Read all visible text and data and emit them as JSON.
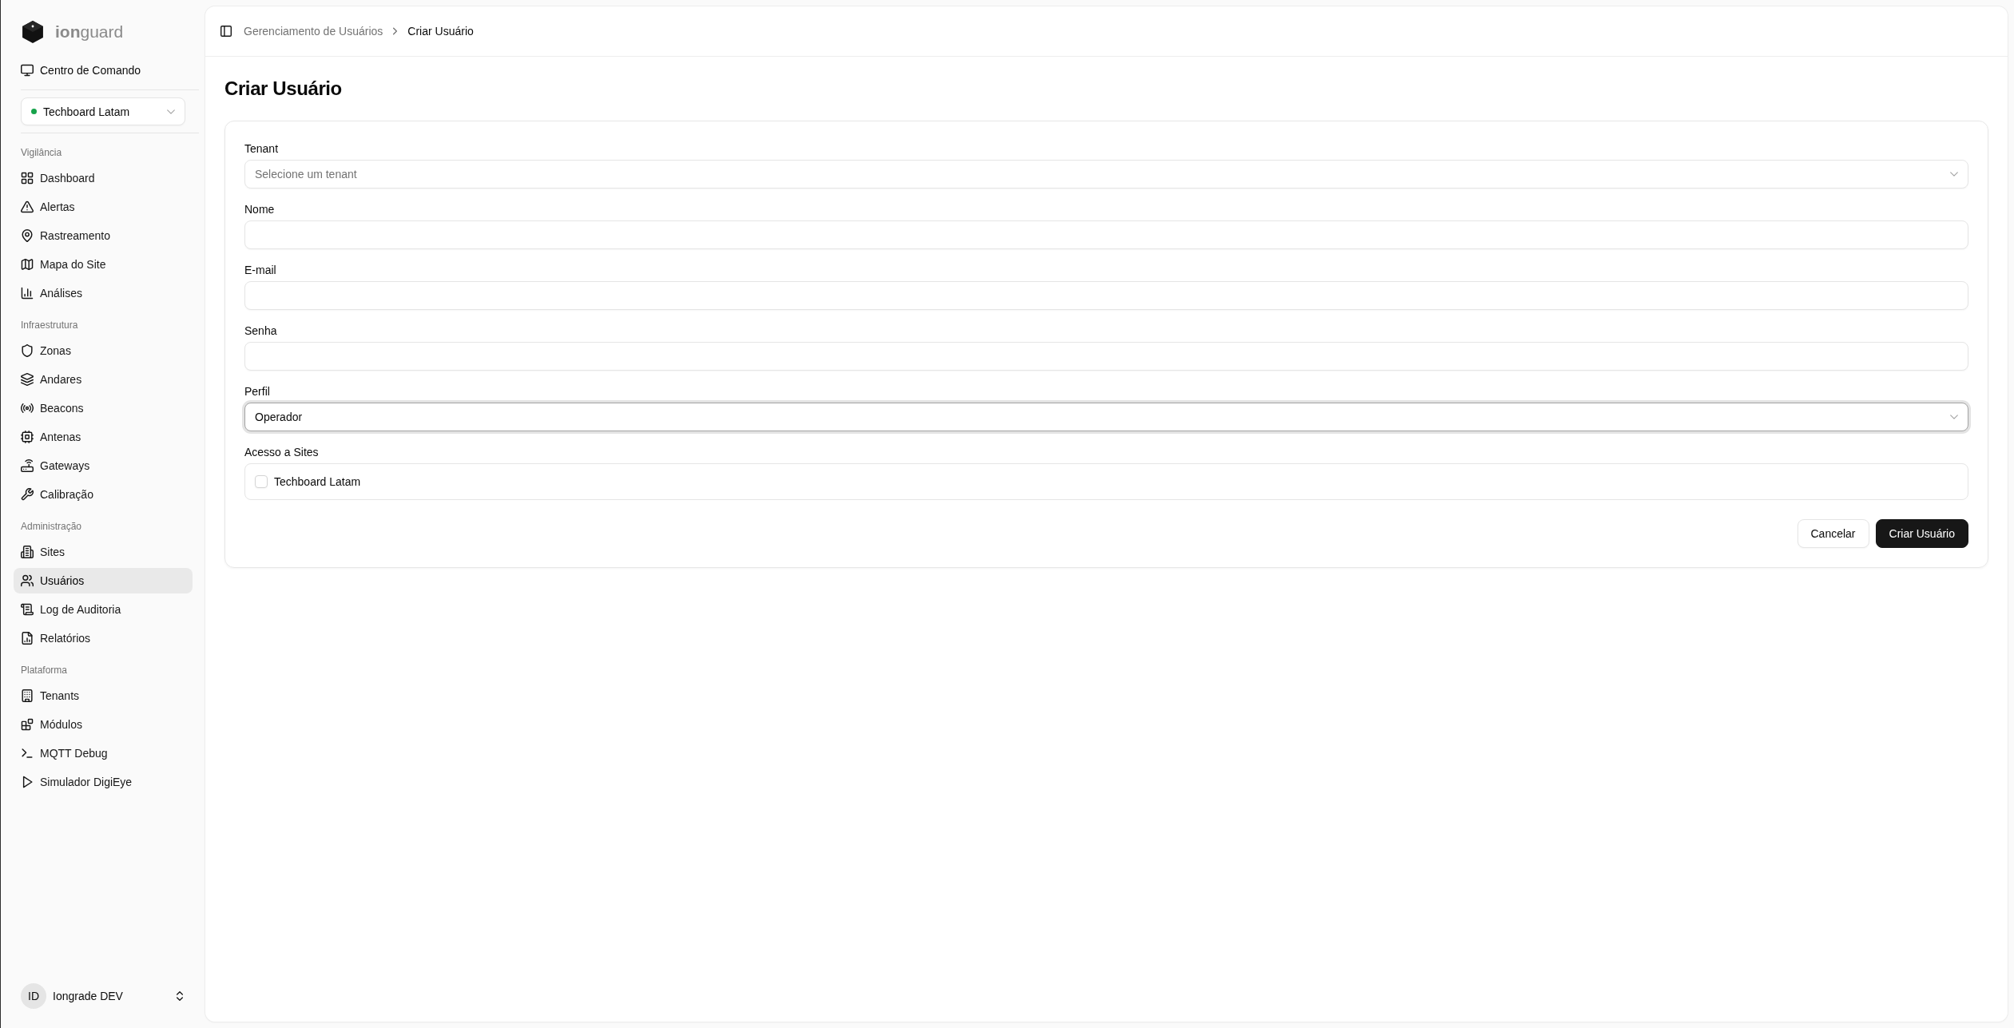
{
  "sidebar": {
    "brand": "**ion**guard",
    "command_center": {
      "label": "Centro de Comando"
    },
    "site_switcher": {
      "label": "Techboard Latam",
      "online": true
    },
    "groups": [
      {
        "label": "Vigilância",
        "items": [
          {
            "label": "Dashboard",
            "selected": false
          },
          {
            "label": "Alertas",
            "selected": false
          },
          {
            "label": "Rastreamento",
            "selected": false
          },
          {
            "label": "Mapa do Site",
            "selected": false
          },
          {
            "label": "Análises",
            "selected": false
          }
        ]
      },
      {
        "label": "Infraestrutura",
        "items": [
          {
            "label": "Zonas",
            "selected": false
          },
          {
            "label": "Andares",
            "selected": false
          },
          {
            "label": "Beacons",
            "selected": false
          },
          {
            "label": "Antenas",
            "selected": false
          },
          {
            "label": "Gateways",
            "selected": false
          },
          {
            "label": "Calibração",
            "selected": false
          }
        ]
      },
      {
        "label": "Administração",
        "items": [
          {
            "label": "Sites",
            "selected": false
          },
          {
            "label": "Usuários",
            "selected": true
          },
          {
            "label": "Log de Auditoria",
            "selected": false
          },
          {
            "label": "Relatórios",
            "selected": false
          }
        ]
      },
      {
        "label": "Plataforma",
        "items": [
          {
            "label": "Tenants",
            "selected": false
          },
          {
            "label": "Módulos",
            "selected": false
          },
          {
            "label": "MQTT Debug",
            "selected": false
          },
          {
            "label": "Simulador DigiEye",
            "selected": false
          }
        ]
      }
    ],
    "user": {
      "initials": "ID",
      "name": "Iongrade DEV"
    }
  },
  "header": {
    "breadcrumb": [
      {
        "label": "Gerenciamento de Usuários",
        "current": false
      },
      {
        "label": "Criar Usuário",
        "current": true
      }
    ]
  },
  "page": {
    "title": "Criar Usuário"
  },
  "form": {
    "fields": [
      {
        "label": "Tenant",
        "kind": "select",
        "placeholder": "Selecione um tenant",
        "focused": false
      },
      {
        "label": "Nome",
        "kind": "input",
        "focused": false
      },
      {
        "label": "E-mail",
        "kind": "input",
        "focused": false
      },
      {
        "label": "Senha",
        "kind": "input",
        "focused": false
      },
      {
        "label": "Perfil",
        "kind": "select",
        "value": "Operador",
        "focused": true
      },
      {
        "label": "Acesso a Sites",
        "kind": "checklist",
        "focused": false,
        "options": [
          {
            "label": "Techboard Latam",
            "checked": false
          }
        ]
      }
    ],
    "buttons": [
      {
        "label": "Cancelar",
        "kind": "outline"
      },
      {
        "label": "Criar Usuário",
        "kind": "primary"
      }
    ]
  }
}
